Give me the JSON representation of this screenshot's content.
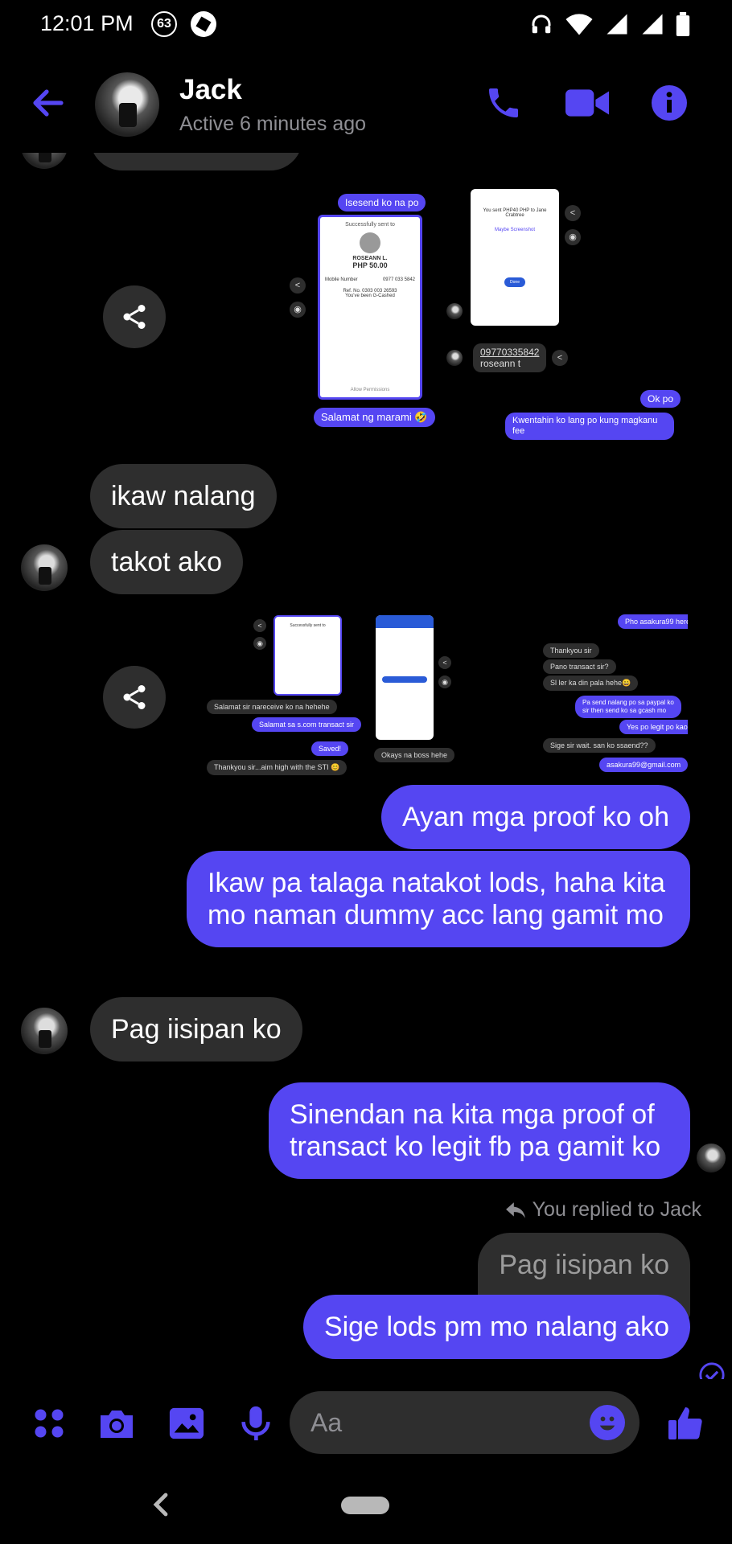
{
  "status_bar": {
    "time": "12:01 PM",
    "notification_count": "63"
  },
  "header": {
    "contact_name": "Jack",
    "presence": "Active 6 minutes ago"
  },
  "attachment_1": {
    "top_bubble": "Isesend ko na po",
    "receipt_title": "Successfully sent to",
    "receipt_name": "ROSEANN L.",
    "receipt_amount": "PHP 50.00",
    "receipt_mobile_label": "Mobile Number",
    "receipt_mobile_value": "0977 033 5842",
    "receipt_ref": "Ref. No. 0303 003 26593",
    "receipt_note": "You've been G-Cashed",
    "receipt_footer": "Allow Permissions",
    "bubble_thanks": "Salamat ng marami 🤣",
    "phone2_text": "You sent PHP40 PHP to Jane Crabtree",
    "phone2_sub": "Maybe Screenshot",
    "phone2_btn": "Done",
    "number_bubble_line1": "09770335842",
    "number_bubble_line2": "roseann t",
    "bubble_ok": "Ok po",
    "bubble_kwenta": "Kwentahin ko lang po kung magkanu fee"
  },
  "attachment_2": {
    "b1": "Salamat sir nareceive ko na hehehe",
    "b2": "Salamat sa s.com transact sir",
    "b3": "Saved!",
    "b4": "Thankyou sir...aim high with the STI 😊",
    "b5": "Okays na boss hehe",
    "b6": "Pho asakura99 here",
    "b7": "Thankyou sir",
    "b8": "Pano transact sir?",
    "b9": "Sl ler ka din pala hehe😄",
    "b10": "Pa send nalang po sa paypal ko sir then send ko sa gcash mo",
    "b11": "Yes po legit po kao",
    "b12": "Sige sir wait. san ko ssaend??",
    "b13": "asakura99@gmail.com",
    "receipt_title": "Successfully sent to"
  },
  "messages": {
    "m1": "ikaw nalang",
    "m2": "takot ako",
    "m3": "Ayan mga proof ko oh",
    "m4": "Ikaw pa talaga natakot lods, haha kita mo naman dummy acc lang gamit mo",
    "m5": "Pag iisipan ko",
    "m6": "Sinendan na kita mga proof of transact ko legit fb pa gamit ko",
    "replied_label": "You replied to Jack",
    "quoted": "Pag iisipan ko",
    "m7": "Sige lods pm mo nalang ako"
  },
  "composer": {
    "placeholder": "Aa"
  },
  "colors": {
    "accent": "#5546f2",
    "incoming_bubble": "#2e2e2e",
    "background": "#000000",
    "secondary_text": "#8e8e93"
  },
  "icons": [
    "back-arrow-icon",
    "phone-icon",
    "video-icon",
    "info-icon",
    "share-icon",
    "camera-icon",
    "apps-icon",
    "gallery-icon",
    "mic-icon",
    "emoji-icon",
    "like-icon",
    "reply-icon",
    "seen-check-icon"
  ]
}
